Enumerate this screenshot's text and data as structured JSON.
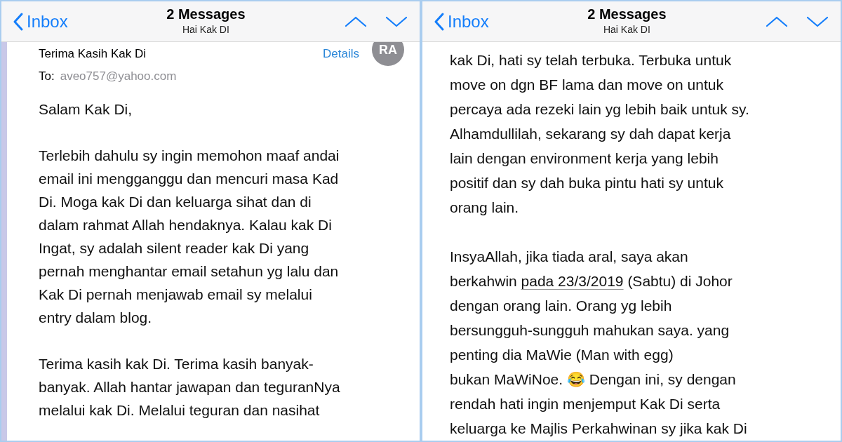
{
  "panels": [
    {
      "header": {
        "back": "Inbox",
        "title": "2 Messages",
        "subtitle": "Hai Kak DI"
      },
      "message": {
        "avatar": "RA",
        "subject": "Terima Kasih Kak Di",
        "details": "Details",
        "to_label": "To:",
        "to_address": "aveo757@yahoo.com"
      },
      "paragraphs": [
        {
          "lines": [
            "Salam Kak Di,"
          ]
        },
        {
          "lines": [
            "Terlebih dahulu sy ingin memohon maaf andai",
            "email ini mengganggu dan mencuri masa Kad",
            "Di. Moga kak Di dan keluarga sihat dan di",
            "dalam rahmat Allah hendaknya. Kalau kak Di",
            "Ingat, sy adalah silent reader kak Di yang",
            "pernah menghantar email setahun yg lalu dan",
            "Kak Di pernah menjawab email sy melalui",
            "entry dalam blog."
          ]
        },
        {
          "lines": [
            "Terima kasih kak Di. Terima kasih banyak-",
            "banyak. Allah hantar jawapan dan teguranNya",
            "melalui kak Di. Melalui teguran dan nasihat"
          ]
        }
      ]
    },
    {
      "header": {
        "back": "Inbox",
        "title": "2 Messages",
        "subtitle": "Hai Kak DI"
      },
      "paragraphs": [
        {
          "lines": [
            "kak Di, hati sy telah terbuka. Terbuka untuk",
            "move on dgn BF lama dan move on untuk",
            "percaya ada rezeki lain yg lebih baik untuk sy.",
            "Alhamdullilah, sekarang sy dah dapat kerja",
            "lain dengan environment kerja yang lebih",
            "positif dan sy dah buka pintu hati sy untuk",
            "orang lain."
          ]
        },
        {
          "lines": [
            "InsyaAllah, jika tiada aral, saya akan",
            [
              {
                "kind": "text",
                "text": "berkahwin "
              },
              {
                "kind": "link",
                "text": "pada 23/3/2019"
              },
              {
                "kind": "text",
                "text": " (Sabtu) di Johor"
              }
            ],
            "dengan orang lain. Orang yg lebih",
            "bersungguh-sungguh mahukan saya. yang",
            "penting dia MaWie (Man with egg)",
            "bukan MaWiNoe. 😂 Dengan ini, sy dengan",
            "rendah hati ingin menjemput Kak Di serta",
            "keluarga ke Majlis Perkahwinan sy jika kak Di"
          ]
        }
      ]
    }
  ]
}
